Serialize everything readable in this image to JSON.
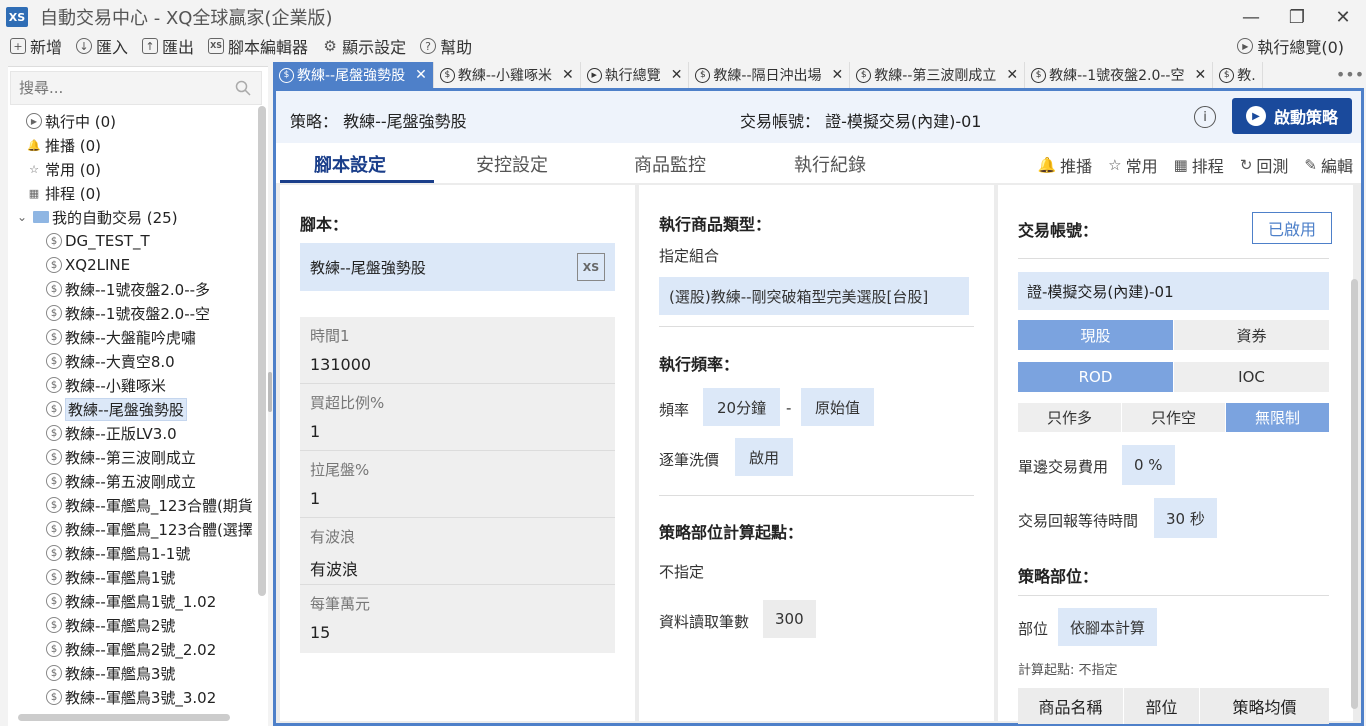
{
  "window": {
    "logo": "XS",
    "title": "自動交易中心 - XQ全球贏家(企業版)",
    "controls": [
      "—",
      "❐",
      "✕"
    ]
  },
  "menu": {
    "items": [
      {
        "icon": "+",
        "label": "新增"
      },
      {
        "icon": "↓",
        "label": "匯入"
      },
      {
        "icon": "↑",
        "label": "匯出"
      },
      {
        "icon": "XS",
        "label": "腳本編輯器"
      },
      {
        "icon": "⚙",
        "label": "顯示設定"
      },
      {
        "icon": "?",
        "label": "幫助"
      }
    ],
    "overview": "執行總覽(0)"
  },
  "sidebar": {
    "search_placeholder": "搜尋...",
    "top_items": [
      {
        "icon": "▶",
        "label": "執行中 (0)"
      },
      {
        "icon": "🔔",
        "label": "推播 (0)"
      },
      {
        "icon": "☆",
        "label": "常用 (0)"
      },
      {
        "icon": "▦",
        "label": "排程 (0)"
      }
    ],
    "folder": {
      "label": "我的自動交易 (25)",
      "expander": "⌄"
    },
    "scripts": [
      "DG_TEST_T",
      "XQ2LINE",
      "教練--1號夜盤2.0--多",
      "教練--1號夜盤2.0--空",
      "教練--大盤龍吟虎嘯",
      "教練--大賣空8.0",
      "教練--小雞啄米",
      "教練--尾盤強勢股",
      "教練--正版LV3.0",
      "教練--第三波剛成立",
      "教練--第五波剛成立",
      "教練--軍艦鳥_123合體(期貨",
      "教練--軍艦鳥_123合體(選擇",
      "教練--軍艦鳥1-1號",
      "教練--軍艦鳥1號",
      "教練--軍艦鳥1號_1.02",
      "教練--軍艦鳥2號",
      "教練--軍艦鳥2號_2.02",
      "教練--軍艦鳥3號",
      "教練--軍艦鳥3號_3.02"
    ],
    "selected_index": 7
  },
  "tabs": [
    {
      "label": "教練--尾盤強勢股",
      "active": true
    },
    {
      "label": "教練--小雞啄米",
      "active": false
    },
    {
      "label": "執行總覽",
      "active": false,
      "play": true
    },
    {
      "label": "教練--隔日沖出場",
      "active": false
    },
    {
      "label": "教練--第三波剛成立",
      "active": false
    },
    {
      "label": "教練--1號夜盤2.0--空",
      "active": false
    },
    {
      "label": "教.",
      "active": false
    }
  ],
  "strategy": {
    "name_label": "策略： 教練--尾盤強勢股",
    "account_label": "交易帳號： 證-模擬交易(內建)-01",
    "start_button": "啟動策略"
  },
  "subtabs": [
    "腳本設定",
    "安控設定",
    "商品監控",
    "執行紀錄"
  ],
  "actions": [
    {
      "icon": "🔔",
      "label": "推播"
    },
    {
      "icon": "☆",
      "label": "常用"
    },
    {
      "icon": "▦",
      "label": "排程"
    },
    {
      "icon": "↻",
      "label": "回測"
    },
    {
      "icon": "✎",
      "label": "編輯"
    }
  ],
  "script_panel": {
    "heading": "腳本：",
    "script_name": "教練--尾盤強勢股",
    "params": [
      {
        "name": "時間1",
        "value": "131000"
      },
      {
        "name": "買超比例%",
        "value": "1"
      },
      {
        "name": "拉尾盤%",
        "value": "1"
      },
      {
        "name": "有波浪",
        "value": "有波浪"
      },
      {
        "name": "每筆萬元",
        "value": "15"
      }
    ]
  },
  "exec_panel": {
    "type_heading": "執行商品類型：",
    "type_sub": "指定組合",
    "combo": "(選股)教練--剛突破箱型完美選股[台股]",
    "freq_heading": "執行頻率：",
    "freq_label": "頻率",
    "freq_value": "20分鐘",
    "freq_dash": "-",
    "freq_raw": "原始值",
    "tick_label": "逐筆洗價",
    "tick_value": "啟用",
    "pos_heading": "策略部位計算起點：",
    "pos_value": "不指定",
    "bars_label": "資料讀取筆數",
    "bars_value": "300"
  },
  "account_panel": {
    "heading": "交易帳號：",
    "enabled": "已啟用",
    "account": "證-模擬交易(內建)-01",
    "type_seg": [
      {
        "label": "現股",
        "on": true
      },
      {
        "label": "資券",
        "on": false
      }
    ],
    "order_seg": [
      {
        "label": "ROD",
        "on": true
      },
      {
        "label": "IOC",
        "on": false
      }
    ],
    "dir_seg": [
      {
        "label": "只作多",
        "on": false
      },
      {
        "label": "只作空",
        "on": false
      },
      {
        "label": "無限制",
        "on": true
      }
    ],
    "fee_label": "單邊交易費用",
    "fee_value": "0 %",
    "wait_label": "交易回報等待時間",
    "wait_value": "30 秒",
    "pos_heading": "策略部位：",
    "pos_label": "部位",
    "pos_value": "依腳本計算",
    "calc_note": "計算起點: 不指定",
    "table_cols": [
      "商品名稱",
      "部位",
      "策略均價"
    ]
  },
  "colors": {
    "accent": "#4e80c9",
    "primary_dark": "#1a4a9c",
    "chip_bg": "#dce8f8",
    "seg_on": "#7ba3df"
  }
}
